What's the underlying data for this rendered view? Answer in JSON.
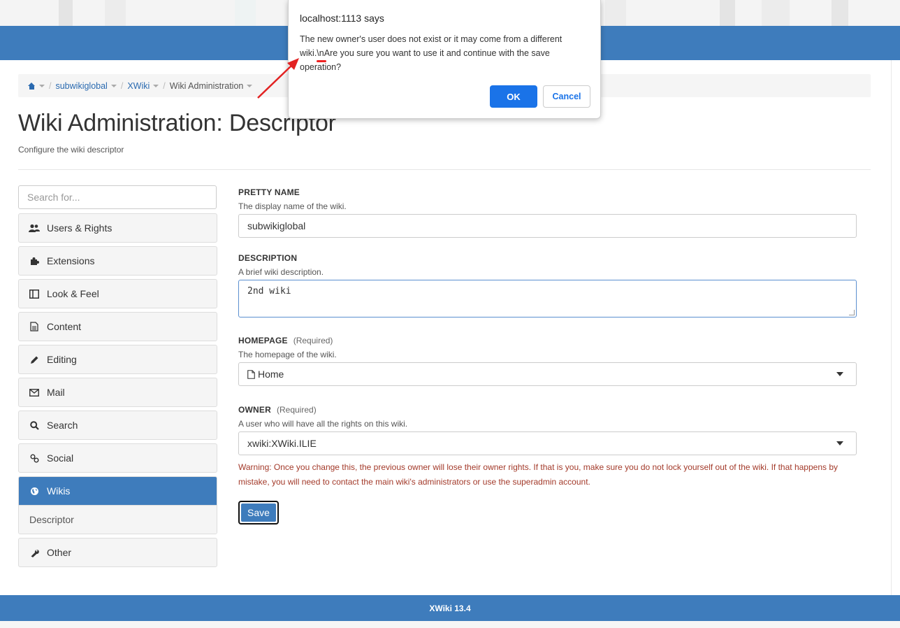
{
  "dialog": {
    "title": "localhost:1113 says",
    "message": "The new owner's user does not exist or it may come from a different wiki.\\nAre you sure you want to use it and continue with the save operation?",
    "ok_label": "OK",
    "cancel_label": "Cancel"
  },
  "breadcrumb": {
    "items": [
      "subwikiglobal",
      "XWiki",
      "Wiki Administration"
    ]
  },
  "page": {
    "title": "Wiki Administration: Descriptor",
    "subtitle": "Configure the wiki descriptor"
  },
  "sidebar": {
    "search_placeholder": "Search for...",
    "items": [
      {
        "label": "Users & Rights",
        "icon": "users-icon"
      },
      {
        "label": "Extensions",
        "icon": "puzzle-icon"
      },
      {
        "label": "Look & Feel",
        "icon": "layout-icon"
      },
      {
        "label": "Content",
        "icon": "document-icon"
      },
      {
        "label": "Editing",
        "icon": "pencil-icon"
      },
      {
        "label": "Mail",
        "icon": "envelope-icon"
      },
      {
        "label": "Search",
        "icon": "search-icon"
      },
      {
        "label": "Social",
        "icon": "link-icon"
      },
      {
        "label": "Wikis",
        "icon": "globe-icon"
      },
      {
        "label": "Other",
        "icon": "wrench-icon"
      }
    ],
    "sub_item": "Descriptor"
  },
  "form": {
    "pretty_name": {
      "label": "PRETTY NAME",
      "hint": "The display name of the wiki.",
      "value": "subwikiglobal"
    },
    "description": {
      "label": "DESCRIPTION",
      "hint": "A brief wiki description.",
      "value": "2nd wiki"
    },
    "homepage": {
      "label": "HOMEPAGE",
      "required": "(Required)",
      "hint": "The homepage of the wiki.",
      "value": "Home"
    },
    "owner": {
      "label": "OWNER",
      "required": "(Required)",
      "hint": "A user who will have all the rights on this wiki.",
      "value": "xwiki:XWiki.ILIE"
    },
    "warning": "Warning: Once you change this, the previous owner will lose their owner rights. If that is you, make sure you do not lock yourself out of the wiki. If that happens by mistake, you will need to contact the main wiki's administrators or use the superadmin account.",
    "save_label": "Save"
  },
  "footer": {
    "text": "XWiki 13.4"
  },
  "colors": {
    "brand": "#3e7cbc",
    "dialog_button": "#1a73e8",
    "warning": "#a33a2a",
    "annotation": "#e22222"
  }
}
